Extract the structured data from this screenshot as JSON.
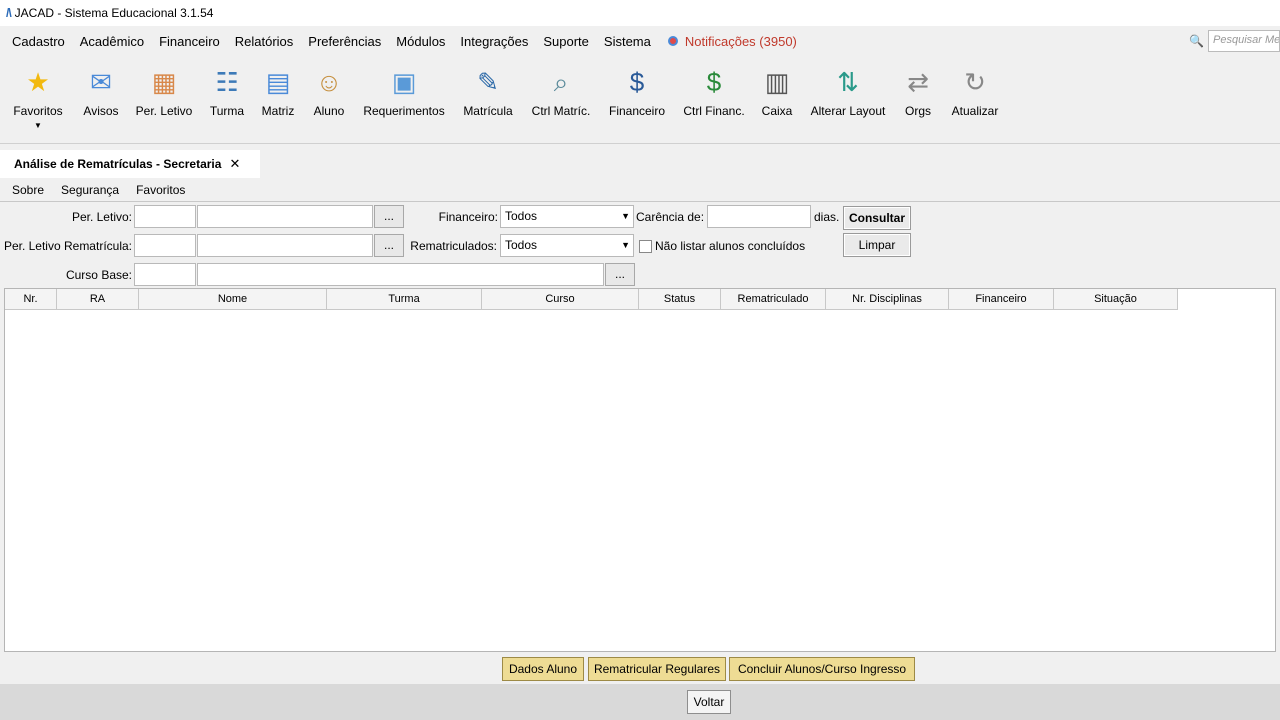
{
  "window": {
    "title": "JACAD - Sistema Educacional 3.1.54"
  },
  "menu": {
    "items": [
      "Cadastro",
      "Acadêmico",
      "Financeiro",
      "Relatórios",
      "Preferências",
      "Módulos",
      "Integrações",
      "Suporte",
      "Sistema"
    ],
    "notifications": "Notificações (3950)",
    "search_placeholder": "Pesquisar Me"
  },
  "toolbar": {
    "favoritos": "Favoritos",
    "avisos": "Avisos",
    "per_letivo": "Per. Letivo",
    "turma": "Turma",
    "matriz": "Matriz",
    "aluno": "Aluno",
    "requerimentos": "Requerimentos",
    "matricula": "Matrícula",
    "ctrl_matric": "Ctrl Matríc.",
    "financeiro": "Financeiro",
    "ctrl_financ": "Ctrl Financ.",
    "caixa": "Caixa",
    "alterar_layout": "Alterar Layout",
    "orgs": "Orgs",
    "atualizar": "Atualizar"
  },
  "tab": {
    "title": "Análise de Rematrículas - Secretaria",
    "close": "✕"
  },
  "submenu": [
    "Sobre",
    "Segurança",
    "Favoritos"
  ],
  "form": {
    "per_letivo_label": "Per. Letivo:",
    "per_letivo_remat_label": "Per. Letivo Rematrícula:",
    "curso_base_label": "Curso Base:",
    "browse": "...",
    "financeiro_label": "Financeiro:",
    "financeiro_value": "Todos",
    "rematriculados_label": "Rematriculados:",
    "rematriculados_value": "Todos",
    "carencia_label": "Carência de:",
    "dias_label": "dias.",
    "nao_listar_label": "Não listar alunos concluídos",
    "consultar": "Consultar",
    "limpar": "Limpar"
  },
  "table": {
    "columns": [
      "Nr.",
      "RA",
      "Nome",
      "Turma",
      "Curso",
      "Status",
      "Rematriculado",
      "Nr. Disciplinas",
      "Financeiro",
      "Situação"
    ]
  },
  "actions": {
    "dados_aluno": "Dados Aluno",
    "rematricular": "Rematricular Regulares",
    "concluir": "Concluir Alunos/Curso Ingresso",
    "voltar": "Voltar"
  }
}
